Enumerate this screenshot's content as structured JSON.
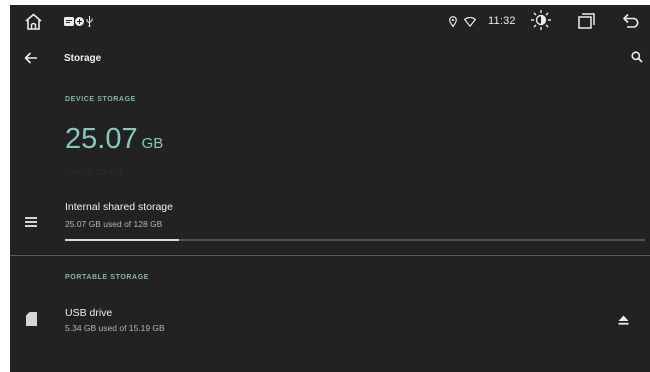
{
  "statusbar": {
    "home_icon": "home-icon",
    "notification_icons": [
      "message-icon",
      "plus-circle-icon",
      "usb-icon"
    ],
    "location_icon": "location-pin-icon",
    "wifi_icon": "wifi-icon",
    "time": "11:32",
    "brightness_icon": "brightness-icon",
    "recents_icon": "recent-apps-icon",
    "back_icon": "back-arrow-icon"
  },
  "toolbar": {
    "title": "Storage",
    "nav_back_icon": "arrow-left-icon",
    "search_icon": "search-icon"
  },
  "device_storage": {
    "header": "DEVICE STORAGE",
    "used_value": "25.07",
    "used_unit": "GB",
    "used_caption": "Used of 128 GB",
    "items": [
      {
        "icon": "list-icon",
        "title": "Internal shared storage",
        "subtitle": "25.07 GB used of 128 GB",
        "used_fraction": 0.1959
      }
    ]
  },
  "portable_storage": {
    "header": "PORTABLE STORAGE",
    "items": [
      {
        "icon": "sd-card-icon",
        "title": "USB drive",
        "subtitle": "5.34 GB used of 15.19 GB",
        "action_icon": "eject-icon"
      }
    ]
  },
  "colors": {
    "background": "#222222",
    "accent": "#86c8bd",
    "section_header": "#7fb5ad",
    "progress_fill": "#d9d9d9",
    "progress_track": "#515151"
  }
}
